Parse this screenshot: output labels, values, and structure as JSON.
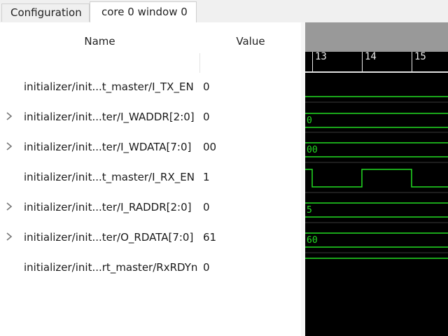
{
  "tabs": [
    {
      "label": "Configuration",
      "active": false
    },
    {
      "label": "core 0 window 0",
      "active": true
    }
  ],
  "columns": {
    "name": "Name",
    "value": "Value"
  },
  "signals": [
    {
      "name": "initializer/init...t_master/I_TX_EN",
      "value": "0",
      "expandable": false
    },
    {
      "name": "initializer/init...ter/I_WADDR[2:0]",
      "value": "0",
      "expandable": true,
      "bus_value": "0"
    },
    {
      "name": "initializer/init...ter/I_WDATA[7:0]",
      "value": "00",
      "expandable": true,
      "bus_value": "00"
    },
    {
      "name": "initializer/init...t_master/I_RX_EN",
      "value": "1",
      "expandable": false
    },
    {
      "name": "initializer/init...ter/I_RADDR[2:0]",
      "value": "0",
      "expandable": true,
      "bus_value": "5"
    },
    {
      "name": "initializer/init...ter/O_RDATA[7:0]",
      "value": "61",
      "expandable": true,
      "bus_value": "60"
    },
    {
      "name": "initializer/init...rt_master/RxRDYn",
      "value": "0",
      "expandable": false
    }
  ],
  "ruler": {
    "ticks": [
      "13",
      "14",
      "15"
    ]
  },
  "colors": {
    "wave": "#22dd22",
    "wave_bg": "#000000",
    "ruler_text": "#e8e8e8"
  },
  "icons": {
    "expand": "chevron-right-icon"
  }
}
